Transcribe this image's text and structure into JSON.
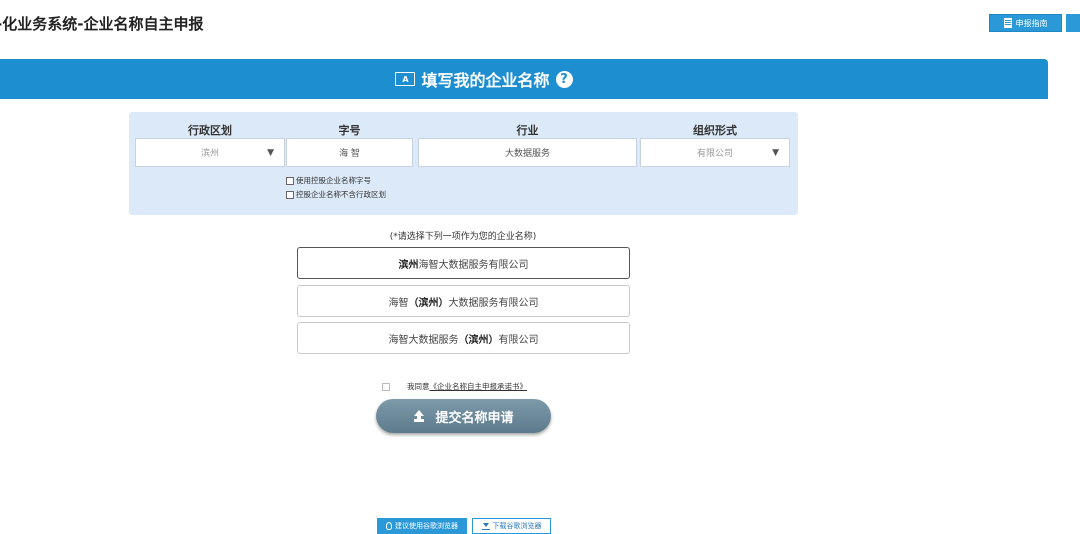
{
  "header": {
    "app_title": "-化业务系统-企业名称自主申报",
    "guide_button": "申报指南"
  },
  "banner": {
    "title": "填写我的企业名称",
    "pen_icon_label": "A"
  },
  "form": {
    "columns": {
      "district": "行政区划",
      "trade_name": "字号",
      "industry": "行业",
      "org_form": "组织形式"
    },
    "district_value": "滨州",
    "trade_name_value": "海 智",
    "industry_value": "大数据服务",
    "org_form_value": "有限公司",
    "check_holding_name": "使用控股企业名称字号",
    "check_no_district": "控股企业名称不含行政区划"
  },
  "options": {
    "hint": "(*请选择下列一项作为您的企业名称)",
    "items": [
      {
        "bold_prefix": "滨州",
        "rest": "海智大数据服务有限公司",
        "selected": true
      },
      {
        "prefix": "海智",
        "bold_middle": "（滨州）",
        "rest": "大数据服务有限公司"
      },
      {
        "prefix": "海智大数据服务",
        "bold_middle": "（滨州）",
        "rest": "有限公司"
      }
    ]
  },
  "agreement": {
    "prefix": "我同意",
    "link": "《企业名称自主申报承诺书》"
  },
  "submit_label": "提交名称申请",
  "footer": {
    "recommend_browser": "建议使用谷歌浏览器",
    "download_browser": "下载谷歌浏览器"
  },
  "colors": {
    "banner": "#1d8fd1",
    "form_panel": "#dbe9f8",
    "submit": "#6b8a9b",
    "accent": "#2b98d8"
  }
}
